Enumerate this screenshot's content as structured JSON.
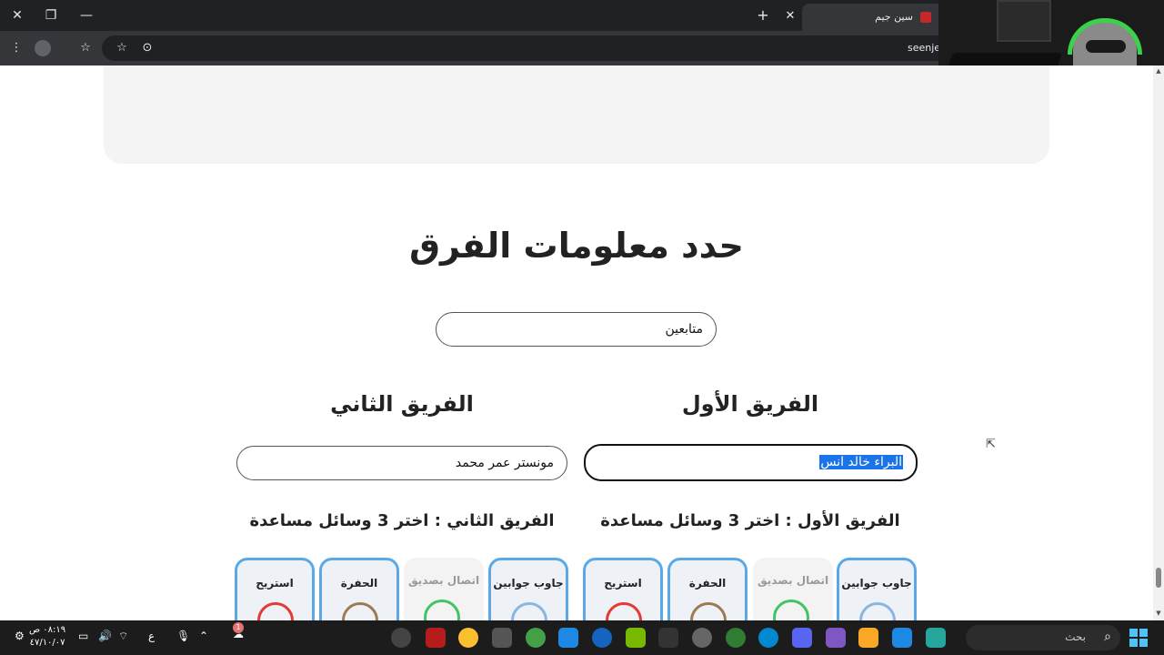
{
  "browser": {
    "tab_title": "سين جيم",
    "url": "seenje",
    "new_tab_symbol": "+",
    "tab_close_symbol": "✕",
    "window_controls": {
      "close": "✕",
      "restore": "❐",
      "minimize": "—"
    }
  },
  "page": {
    "section_title": "حدد معلومات الفرق",
    "mode_input_value": "متابعين",
    "team1": {
      "title": "الفريق الأول",
      "name_value": "البراء خالد انس",
      "aids_title": "الفريق الأول : اختر 3 وسائل مساعدة",
      "aids": [
        {
          "label": "جاوب جوابين",
          "icon": "two-answers-icon",
          "selected": true
        },
        {
          "label": "اتصال بصديق",
          "icon": "phone-friend-icon",
          "selected": false
        },
        {
          "label": "الحفرة",
          "icon": "pit-icon",
          "selected": true
        },
        {
          "label": "استريح",
          "icon": "rest-hand-icon",
          "selected": true
        }
      ]
    },
    "team2": {
      "title": "الفريق الثاني",
      "name_value": "مونستر عمر محمد",
      "aids_title": "الفريق الثاني : اختر 3 وسائل مساعدة",
      "aids": [
        {
          "label": "جاوب جوابين",
          "icon": "two-answers-icon",
          "selected": true
        },
        {
          "label": "اتصال بصديق",
          "icon": "phone-friend-icon",
          "selected": false
        },
        {
          "label": "الحفرة",
          "icon": "pit-icon",
          "selected": true
        },
        {
          "label": "استريح",
          "icon": "rest-hand-icon",
          "selected": true
        }
      ]
    }
  },
  "taskbar": {
    "search_placeholder": "بحث",
    "clock_time": "٠٨:١٩ ص",
    "clock_date": "٤٧/١٠/٠٧",
    "lang": "ع",
    "notification_count": "1"
  },
  "colors": {
    "accent_blue": "#5aa9e6",
    "selection": "#1a73e8",
    "red": "#e53935",
    "green": "#43c463"
  }
}
